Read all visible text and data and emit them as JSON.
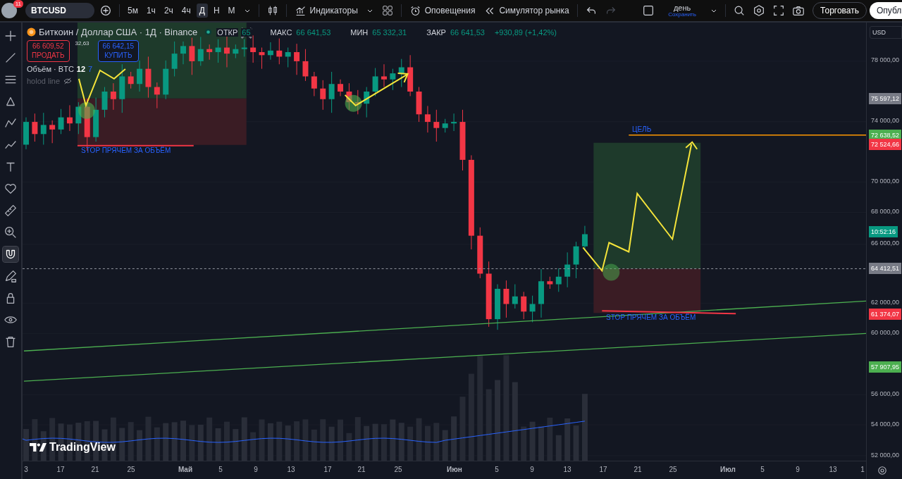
{
  "toolbar": {
    "badge": "11",
    "symbol": "BTCUSD",
    "intervals": [
      {
        "label": "5м",
        "selected": false
      },
      {
        "label": "1ч",
        "selected": false
      },
      {
        "label": "2ч",
        "selected": false
      },
      {
        "label": "4ч",
        "selected": false
      },
      {
        "label": "Д",
        "selected": true
      },
      {
        "label": "Н",
        "selected": false
      },
      {
        "label": "М",
        "selected": false
      }
    ],
    "indicators": "Индикаторы",
    "alerts": "Оповещения",
    "replay": "Симулятор рынка",
    "redo": {
      "disabled": true
    },
    "layout": {
      "name": "день",
      "save": "Сохранить"
    },
    "trade": "Торговать",
    "publish": "Опубл"
  },
  "tools": [
    {
      "kind": "crosshair",
      "selected": false
    },
    {
      "kind": "line",
      "selected": false
    },
    {
      "kind": "lines",
      "selected": false
    },
    {
      "kind": "nodes",
      "selected": false
    },
    {
      "kind": "pattern",
      "selected": false
    },
    {
      "kind": "path",
      "selected": false
    },
    {
      "kind": "text",
      "selected": false
    },
    {
      "kind": "heart",
      "selected": false
    },
    {
      "kind": "ruler",
      "selected": false
    },
    {
      "kind": "zoom",
      "selected": false
    },
    {
      "kind": "magnet",
      "selected": true
    },
    {
      "kind": "pencil",
      "selected": false
    },
    {
      "kind": "lock",
      "selected": false
    },
    {
      "kind": "eye",
      "selected": false
    },
    {
      "kind": "trash",
      "selected": false
    }
  ],
  "legend": {
    "title": "Биткоин / Доллар США · 1Д · Binance",
    "ohlc": [
      {
        "label": "ОТКР",
        "value": "65"
      },
      {
        "label": "МАКС",
        "value": "66 641,53"
      },
      {
        "label": "МИН",
        "value": "65 332,31"
      },
      {
        "label": "ЗАКР",
        "value": "66 641,53"
      }
    ],
    "change": "+930,89 (+1,42%)",
    "sell": {
      "price": "66 609,52",
      "label": "ПРОДАТЬ"
    },
    "spread": "32,63",
    "buy": {
      "price": "66 642,15",
      "label": "КУПИТЬ"
    },
    "volume": {
      "label": "Объём · BTC",
      "value": "12",
      "extra": "7"
    },
    "study": "holod line"
  },
  "chart": {
    "labels": [
      "STOP ПРЯЧЕМ ЗА ОБЪЁМ",
      "ЦЕЛЬ",
      "STOP ПРЯЧЕМ ЗА ОБЪЁМ"
    ],
    "logo": "TradingView"
  },
  "price_axis": {
    "currency": "USD",
    "ticks": [
      "78 000,00",
      "74 000,00",
      "70 000,00",
      "68 000,00",
      "66 000,00",
      "62 000,00",
      "60 000,00",
      "56 000,00",
      "54 000,00",
      "52 000,00"
    ],
    "tags": [
      {
        "text": "75 597,12",
        "color": "#787b86"
      },
      {
        "text": "72 638,52",
        "color": "#4caf50"
      },
      {
        "text": "72 524,66",
        "color": "#f23645"
      },
      {
        "text": "10:52:16",
        "color": "#089981"
      },
      {
        "text": "64 412,51",
        "color": "#787b86"
      },
      {
        "text": "61 374,07",
        "color": "#f23645"
      },
      {
        "text": "57 907,95",
        "color": "#4caf50"
      }
    ]
  },
  "time_axis": [
    {
      "text": "3",
      "kind": "day"
    },
    {
      "text": "17",
      "kind": "day"
    },
    {
      "text": "21",
      "kind": "day"
    },
    {
      "text": "25",
      "kind": "day"
    },
    {
      "text": "Май",
      "kind": "month"
    },
    {
      "text": "5",
      "kind": "day"
    },
    {
      "text": "9",
      "kind": "day"
    },
    {
      "text": "13",
      "kind": "day"
    },
    {
      "text": "17",
      "kind": "day"
    },
    {
      "text": "21",
      "kind": "day"
    },
    {
      "text": "25",
      "kind": "day"
    },
    {
      "text": "Июн",
      "kind": "month"
    },
    {
      "text": "5",
      "kind": "day"
    },
    {
      "text": "9",
      "kind": "day"
    },
    {
      "text": "13",
      "kind": "day"
    },
    {
      "text": "17",
      "kind": "day"
    },
    {
      "text": "21",
      "kind": "day"
    },
    {
      "text": "25",
      "kind": "day"
    },
    {
      "text": "Июл",
      "kind": "month"
    },
    {
      "text": "5",
      "kind": "day"
    },
    {
      "text": "9",
      "kind": "day"
    },
    {
      "text": "13",
      "kind": "day"
    },
    {
      "text": "1",
      "kind": "day"
    }
  ]
}
